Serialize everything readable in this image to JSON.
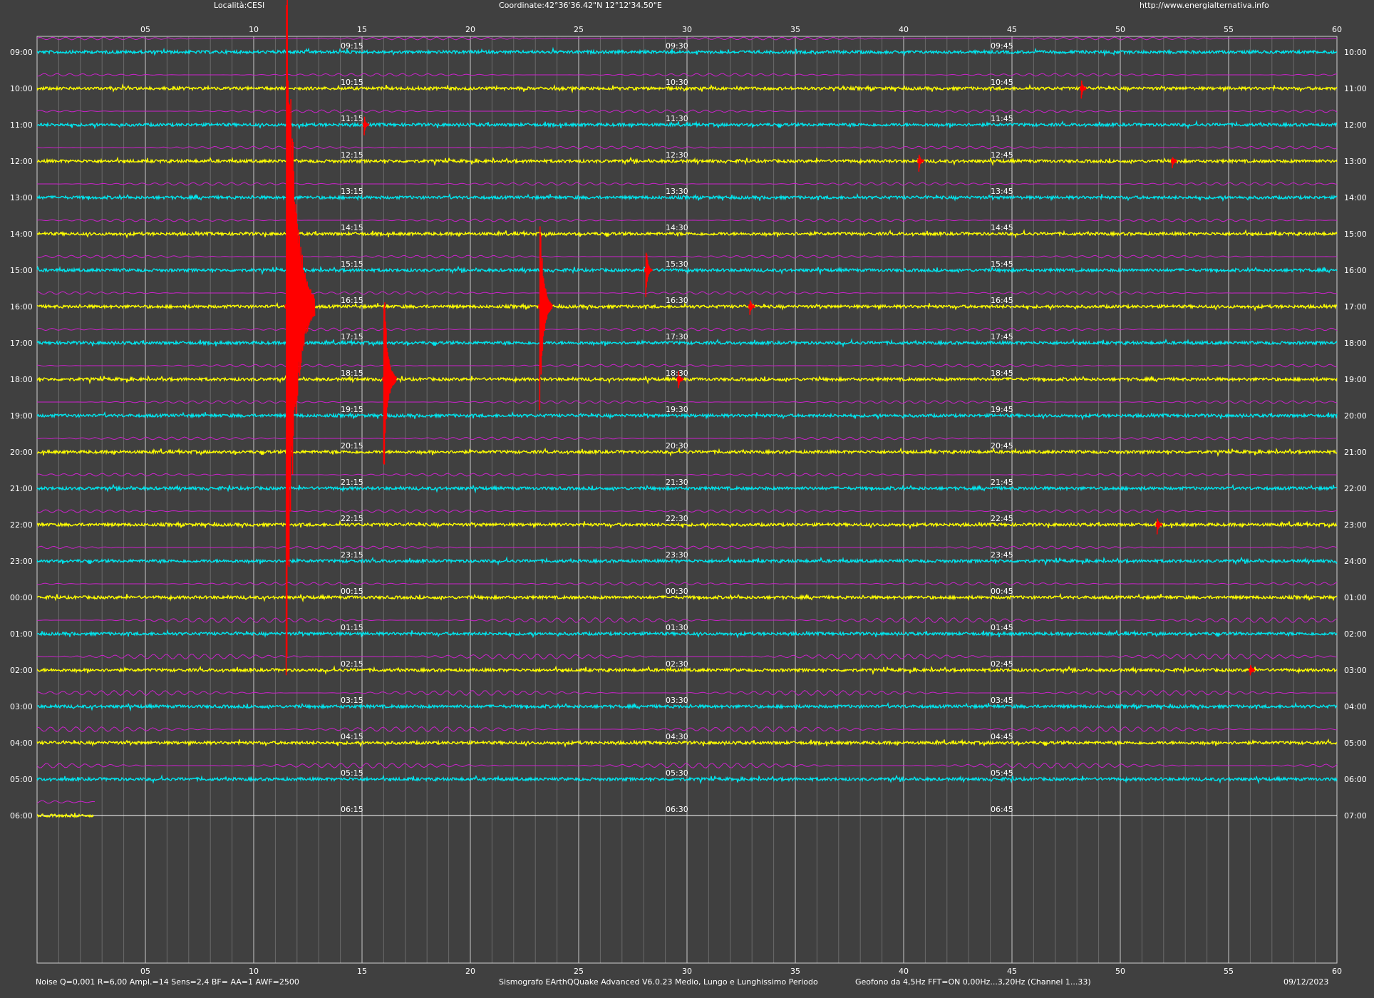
{
  "header": {
    "location": "Località:CESI",
    "coordinates": "Coordinate:42°36'36.42\"N  12°12'34.50\"E",
    "url": "http://www.energialternativa.info"
  },
  "footer": {
    "noise": "Noise Q=0,001 R=6,00 Ampl.=14 Sens=2,4 BF= AA=1 AWF=2500",
    "software": "Sismografo  EArthQQuake Advanced V6.0.23  Medio, Lungo e Lunghissimo Periodo",
    "sensor": "Geofono da 4,5Hz FFT=ON 0,00Hz...3,20Hz      (Channel 1...33)",
    "date": "09/12/2023"
  },
  "colors": {
    "background": "#404040",
    "trace_a": "#00e5ee",
    "trace_b": "#ffff00",
    "long_period": "#cc22cc",
    "event": "#ff0000",
    "text": "#ffffff",
    "grid_major": "#c8c8c8",
    "grid_minor": "#6a6a6a"
  },
  "chart_data": {
    "type": "line",
    "title": "",
    "xlabel": "",
    "ylabel": "",
    "xlim": [
      0,
      60
    ],
    "x_ticks": [
      "05",
      "10",
      "15",
      "20",
      "25",
      "30",
      "35",
      "40",
      "45",
      "50",
      "55",
      "60"
    ],
    "quarter_labels": [
      "15",
      "30",
      "45"
    ],
    "rows": [
      {
        "left": "09:00",
        "right": "10:00",
        "color": "cyan"
      },
      {
        "left": "10:00",
        "right": "11:00",
        "color": "yellow"
      },
      {
        "left": "11:00",
        "right": "12:00",
        "color": "cyan"
      },
      {
        "left": "12:00",
        "right": "13:00",
        "color": "yellow"
      },
      {
        "left": "13:00",
        "right": "14:00",
        "color": "cyan"
      },
      {
        "left": "14:00",
        "right": "15:00",
        "color": "yellow"
      },
      {
        "left": "15:00",
        "right": "16:00",
        "color": "cyan"
      },
      {
        "left": "16:00",
        "right": "17:00",
        "color": "yellow"
      },
      {
        "left": "17:00",
        "right": "18:00",
        "color": "cyan"
      },
      {
        "left": "18:00",
        "right": "19:00",
        "color": "yellow"
      },
      {
        "left": "19:00",
        "right": "20:00",
        "color": "cyan"
      },
      {
        "left": "20:00",
        "right": "21:00",
        "color": "yellow"
      },
      {
        "left": "21:00",
        "right": "22:00",
        "color": "cyan"
      },
      {
        "left": "22:00",
        "right": "23:00",
        "color": "yellow"
      },
      {
        "left": "23:00",
        "right": "24:00",
        "color": "cyan"
      },
      {
        "left": "00:00",
        "right": "01:00",
        "color": "yellow"
      },
      {
        "left": "01:00",
        "right": "02:00",
        "color": "cyan"
      },
      {
        "left": "02:00",
        "right": "03:00",
        "color": "yellow"
      },
      {
        "left": "03:00",
        "right": "04:00",
        "color": "cyan"
      },
      {
        "left": "04:00",
        "right": "05:00",
        "color": "yellow"
      },
      {
        "left": "05:00",
        "right": "06:00",
        "color": "cyan"
      },
      {
        "left": "06:00",
        "right": "07:00",
        "color": "yellow"
      }
    ],
    "current_row_end_minute": 2.6,
    "events": [
      {
        "row": 1,
        "minute": 48.2,
        "amplitude": 0.3
      },
      {
        "row": 2,
        "minute": 15.1,
        "amplitude": 0.3
      },
      {
        "row": 3,
        "minute": 40.7,
        "amplitude": 0.3
      },
      {
        "row": 3,
        "minute": 52.4,
        "amplitude": 0.2
      },
      {
        "row": 6,
        "minute": 28.1,
        "amplitude": 0.8
      },
      {
        "row": 7,
        "minute": 11.5,
        "amplitude": 11.0
      },
      {
        "row": 7,
        "minute": 23.2,
        "amplitude": 2.9
      },
      {
        "row": 7,
        "minute": 32.9,
        "amplitude": 0.3
      },
      {
        "row": 9,
        "minute": 16.0,
        "amplitude": 2.9
      },
      {
        "row": 9,
        "minute": 29.6,
        "amplitude": 0.3
      },
      {
        "row": 13,
        "minute": 51.7,
        "amplitude": 0.3
      },
      {
        "row": 17,
        "minute": 56.0,
        "amplitude": 0.2
      }
    ]
  }
}
